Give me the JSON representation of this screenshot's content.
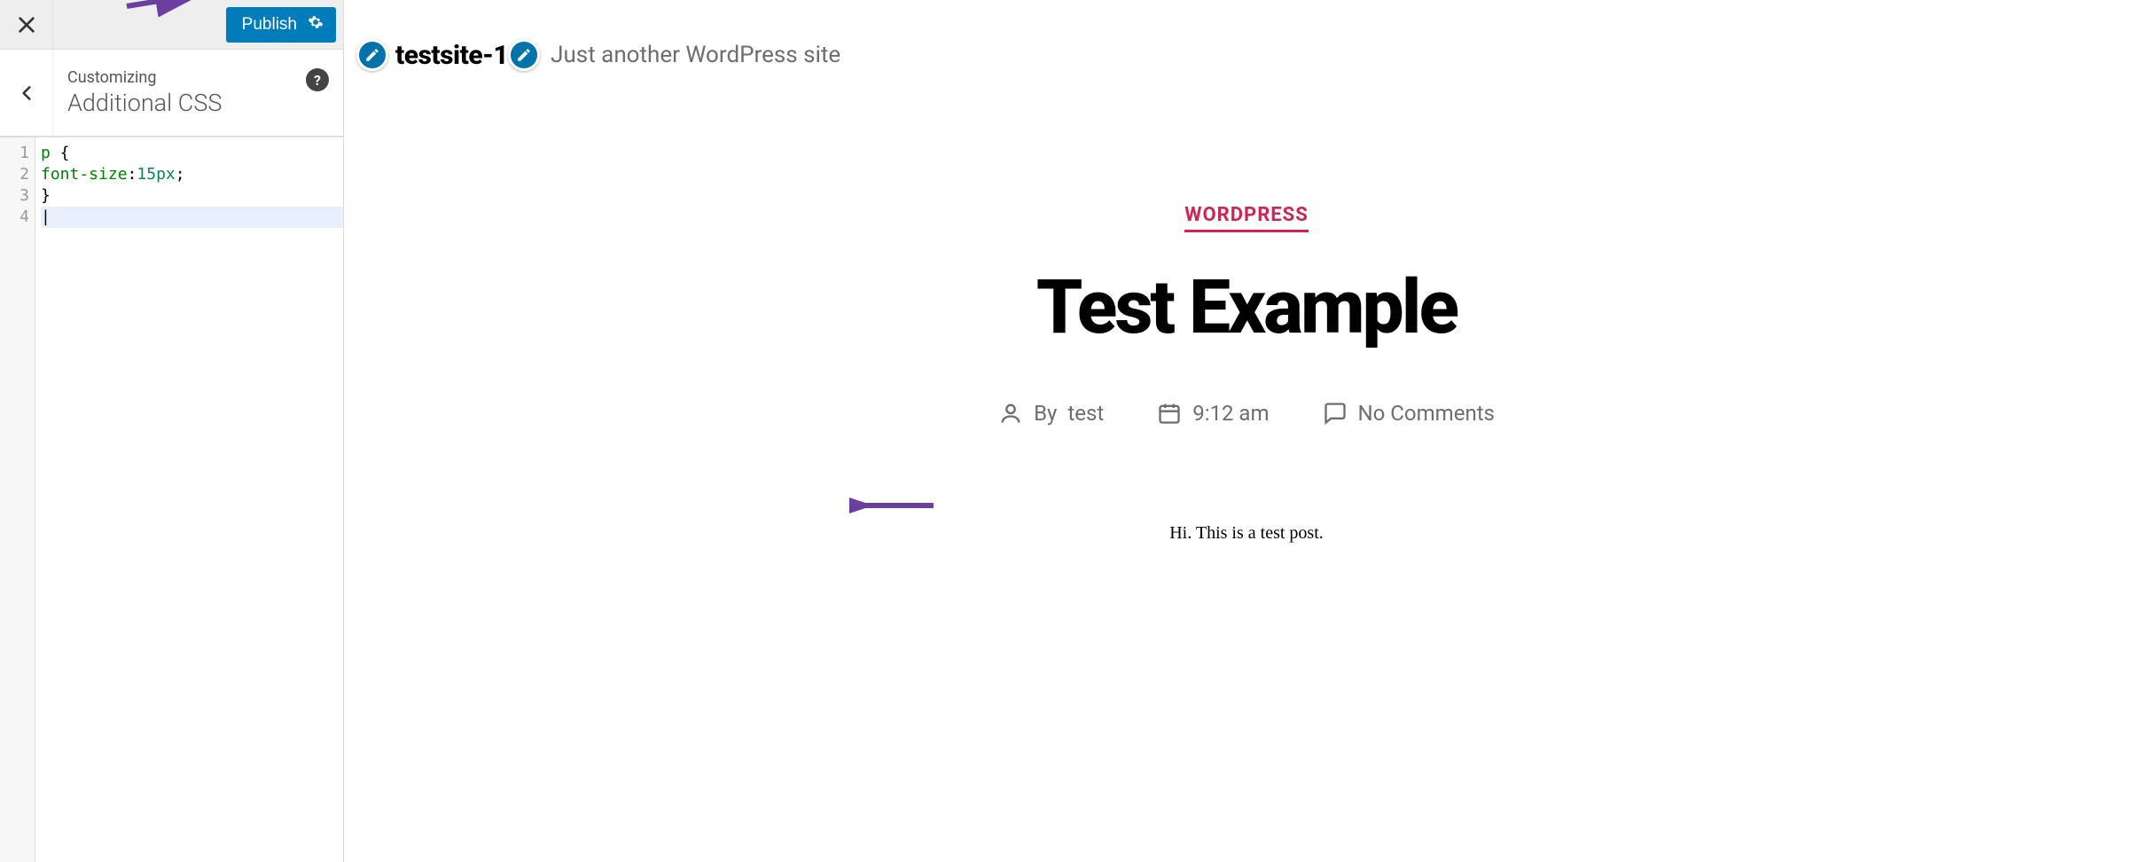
{
  "sidebar": {
    "publish_label": "Publish",
    "panel_subtitle": "Customizing",
    "panel_title": "Additional CSS",
    "code_lines": [
      "p {",
      "font-size:15px;",
      "}",
      ""
    ],
    "line_numbers": [
      "1",
      "2",
      "3",
      "4"
    ]
  },
  "preview": {
    "site_title": "testsite-1",
    "site_tagline": "Just another WordPress site",
    "post": {
      "category": "WORDPRESS",
      "title": "Test Example",
      "author_prefix": "By",
      "author": "test",
      "time": "9:12 am",
      "comments": "No Comments",
      "body": "Hi. This is a test post."
    }
  }
}
